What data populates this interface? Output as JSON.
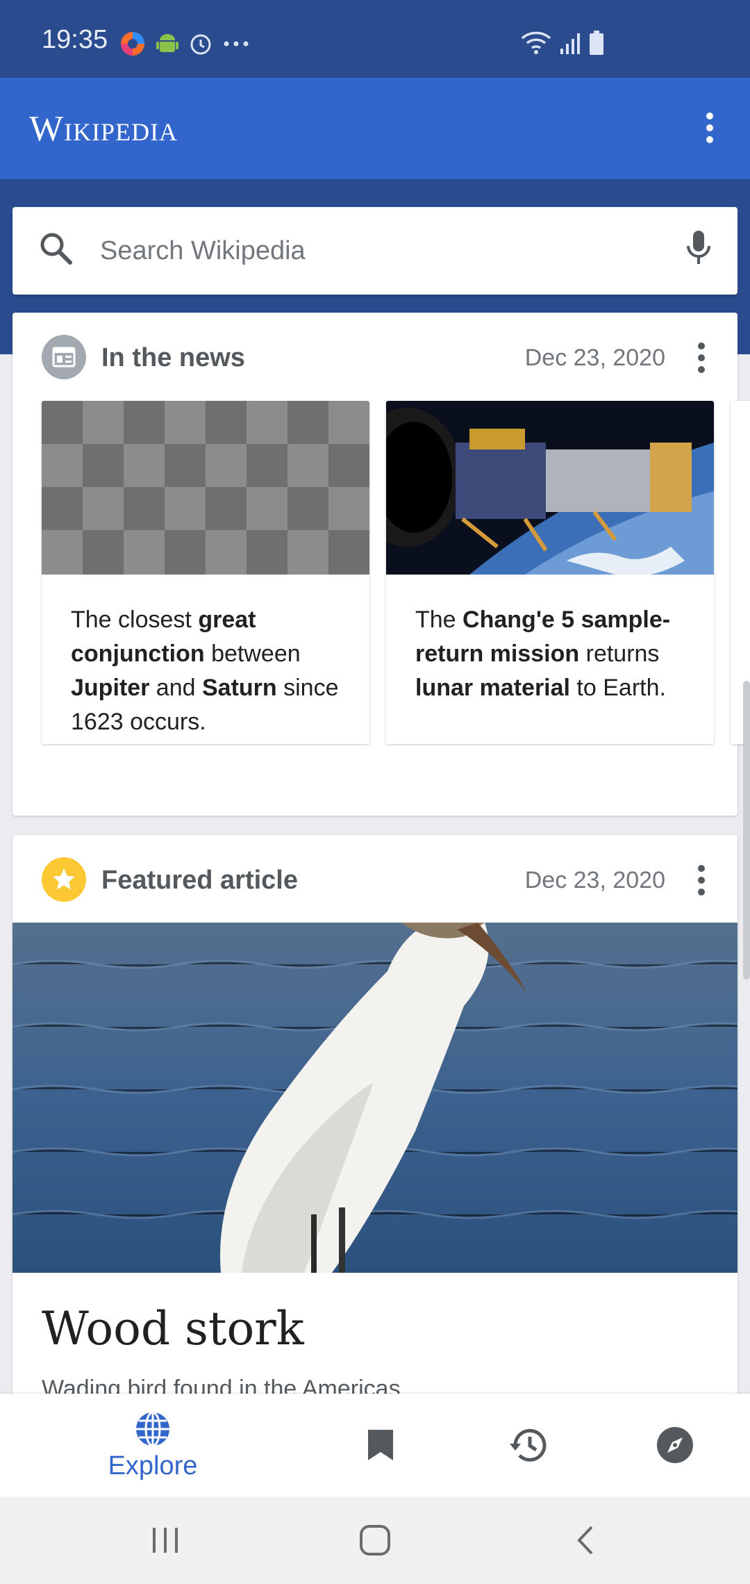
{
  "status": {
    "time": "19:35"
  },
  "app": {
    "title": "Wikipedia"
  },
  "search": {
    "placeholder": "Search Wikipedia"
  },
  "news_card": {
    "title": "In the news",
    "date": "Dec 23, 2020",
    "items": [
      {
        "parts": [
          "The closest ",
          "great conjunction",
          " between ",
          "Jupiter",
          " and ",
          "Saturn",
          " since 1623 occurs."
        ]
      },
      {
        "parts": [
          "The ",
          "Chang'e 5 sample-return mission",
          " returns ",
          "lunar material",
          " to Earth."
        ]
      }
    ]
  },
  "featured_card": {
    "title": "Featured article",
    "date": "Dec 23, 2020",
    "article_title": "Wood stork",
    "article_subtitle": "Wading bird found in the Americas"
  },
  "bottom_nav": {
    "explore_label": "Explore"
  },
  "colors": {
    "accent": "#3366cc",
    "header_dark": "#2a4b8d",
    "star": "#fcc934"
  }
}
